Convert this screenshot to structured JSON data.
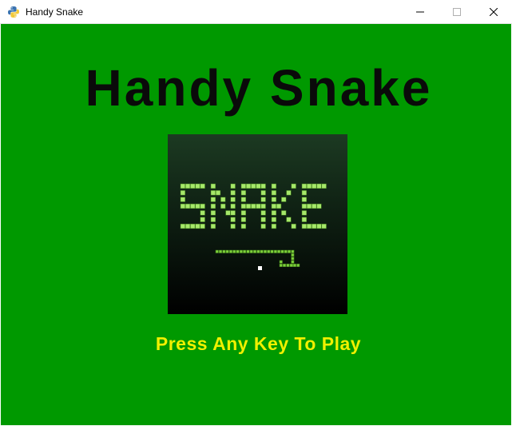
{
  "window": {
    "title": "Handy Snake",
    "app_icon": "python-icon",
    "controls": [
      "minimize-icon",
      "maximize-icon",
      "close-icon"
    ]
  },
  "game": {
    "title": "Handy Snake",
    "logo_text": "SNAKE",
    "prompt": "Press Any Key To Play"
  },
  "colors": {
    "background": "#009900",
    "title": "#0a0a0a",
    "prompt": "#f0f000",
    "snake_pixel": "#7ccf3a",
    "snake_pixel_light": "#a6e86a",
    "food": "#ffffff"
  }
}
